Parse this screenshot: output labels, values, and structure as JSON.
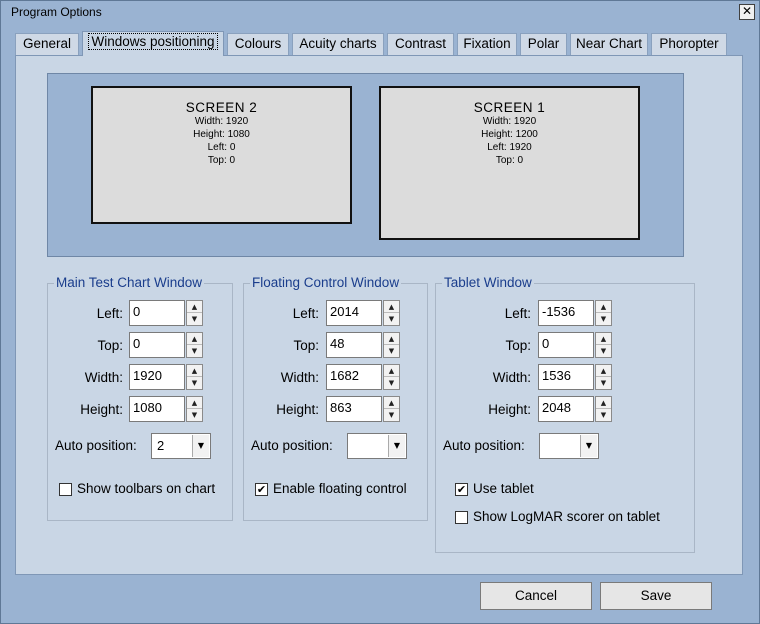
{
  "window": {
    "title": "Program Options",
    "close_glyph": "✕"
  },
  "tabs": [
    {
      "label": "General"
    },
    {
      "label": "Windows positioning",
      "active": true
    },
    {
      "label": "Colours"
    },
    {
      "label": "Acuity charts"
    },
    {
      "label": "Contrast"
    },
    {
      "label": "Fixation"
    },
    {
      "label": "Polar"
    },
    {
      "label": "Near Chart"
    },
    {
      "label": "Phoropter"
    }
  ],
  "screens": [
    {
      "name": "SCREEN  2",
      "width": "Width: 1920",
      "height": "Height: 1080",
      "left": "Left: 0",
      "top": "Top: 0"
    },
    {
      "name": "SCREEN  1",
      "width": "Width: 1920",
      "height": "Height: 1200",
      "left": "Left: 1920",
      "top": "Top: 0"
    }
  ],
  "labels": {
    "left": "Left:",
    "top": "Top:",
    "width": "Width:",
    "height": "Height:",
    "auto_position": "Auto position:"
  },
  "groups": {
    "main_chart": {
      "title": "Main Test Chart Window",
      "left": "0",
      "top": "0",
      "width": "1920",
      "height": "1080",
      "auto_position": "2",
      "checkbox": {
        "label": "Show toolbars on chart",
        "checked": false
      }
    },
    "floating_control": {
      "title": "Floating Control Window",
      "left": "2014",
      "top": "48",
      "width": "1682",
      "height": "863",
      "auto_position": "",
      "checkbox": {
        "label": "Enable floating control",
        "checked": true
      }
    },
    "tablet": {
      "title": "Tablet Window",
      "left": "-1536",
      "top": "0",
      "width": "1536",
      "height": "2048",
      "auto_position": "",
      "checkbox1": {
        "label": "Use tablet",
        "checked": true
      },
      "checkbox2": {
        "label": "Show LogMAR scorer on tablet",
        "checked": false
      }
    }
  },
  "buttons": {
    "cancel": "Cancel",
    "save": "Save"
  },
  "icons": {
    "spin_up": "▲",
    "spin_down": "▼",
    "dropdown": "▼",
    "check": "✔"
  },
  "colors": {
    "frame": "#9ab3d2",
    "panel": "#c9d6e5",
    "group_title": "#1a3d8c"
  }
}
